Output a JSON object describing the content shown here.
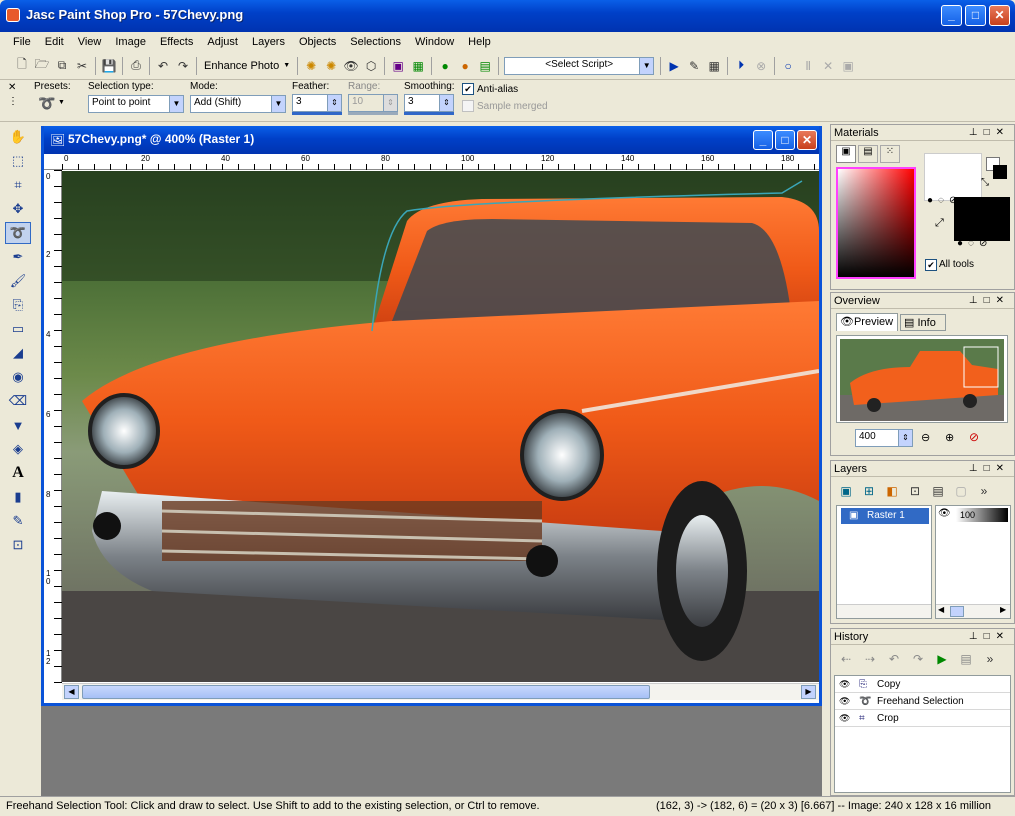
{
  "app": {
    "title": "Jasc Paint Shop Pro - 57Chevy.png",
    "window_buttons": {
      "minimize": "_",
      "maximize": "□",
      "close": "✕"
    }
  },
  "menu": [
    "File",
    "Edit",
    "View",
    "Image",
    "Effects",
    "Adjust",
    "Layers",
    "Objects",
    "Selections",
    "Window",
    "Help"
  ],
  "toolbar": {
    "enhance_photo": "Enhance Photo",
    "script_select": "<Select Script>"
  },
  "tool_options": {
    "presets_label": "Presets:",
    "selection_type_label": "Selection type:",
    "selection_type_value": "Point to point",
    "mode_label": "Mode:",
    "mode_value": "Add (Shift)",
    "feather_label": "Feather:",
    "feather_value": "3",
    "range_label": "Range:",
    "range_value": "10",
    "smoothing_label": "Smoothing:",
    "smoothing_value": "3",
    "antialias_label": "Anti-alias",
    "antialias_checked": true,
    "sample_merged_label": "Sample merged",
    "sample_merged_checked": false
  },
  "document": {
    "title": "57Chevy.png* @ 400% (Raster 1)",
    "hruler_ticks": [
      "0",
      "20",
      "40",
      "60",
      "80",
      "100",
      "120",
      "140",
      "160",
      "180"
    ],
    "vruler_ticks": [
      "0",
      "2",
      "4",
      "6",
      "8",
      "1 0",
      "1 0",
      "1 2"
    ]
  },
  "materials": {
    "title": "Materials",
    "all_tools_label": "All tools",
    "all_tools_checked": true,
    "foreground_color": "#ffffff",
    "background_color": "#000000"
  },
  "overview": {
    "title": "Overview",
    "tab_preview": "Preview",
    "tab_info": "Info",
    "zoom_value": "400"
  },
  "layers": {
    "title": "Layers",
    "layer_name": "Raster 1",
    "opacity": "100"
  },
  "history": {
    "title": "History",
    "items": [
      "Copy",
      "Freehand Selection",
      "Crop"
    ]
  },
  "status": {
    "hint": "Freehand Selection Tool: Click and draw to select. Use Shift to add to the existing selection, or Ctrl to remove.",
    "coords": "(162, 3) -> (182, 6) = (20 x 3) [6.667] -- Image:  240 x 128 x 16 million"
  }
}
